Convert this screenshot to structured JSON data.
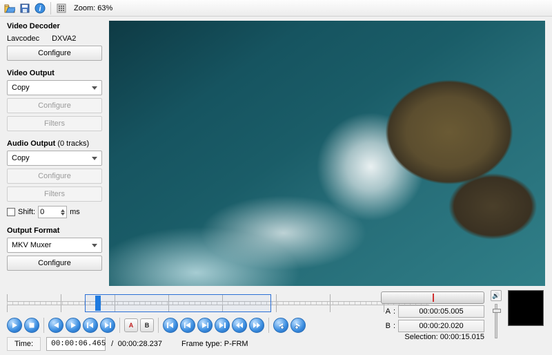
{
  "toolbar": {
    "zoom_label": "Zoom: 63%"
  },
  "sidebar": {
    "decoder": {
      "title": "Video Decoder",
      "codec": "Lavcodec",
      "hw": "DXVA2",
      "configure": "Configure"
    },
    "voutput": {
      "title": "Video Output",
      "selected": "Copy",
      "configure": "Configure",
      "filters": "Filters"
    },
    "aoutput": {
      "title_prefix": "Audio Output",
      "tracks": "(0 tracks)",
      "selected": "Copy",
      "configure": "Configure",
      "filters": "Filters",
      "shift_label": "Shift:",
      "shift_val": "0",
      "ms": "ms"
    },
    "oformat": {
      "title": "Output Format",
      "selected": "MKV Muxer",
      "configure": "Configure"
    }
  },
  "markers": {
    "a": "A",
    "b": "B",
    "a_val": "00:00:05.005",
    "b_val": "00:00:20.020",
    "selection_label": "Selection:",
    "selection_val": "00:00:15.015"
  },
  "status": {
    "time_label": "Time:",
    "time": "00:00:06.465",
    "dur_sep": "/",
    "duration": "00:00:28.237",
    "ftype_label": "Frame type:",
    "ftype": "P-FRM"
  }
}
